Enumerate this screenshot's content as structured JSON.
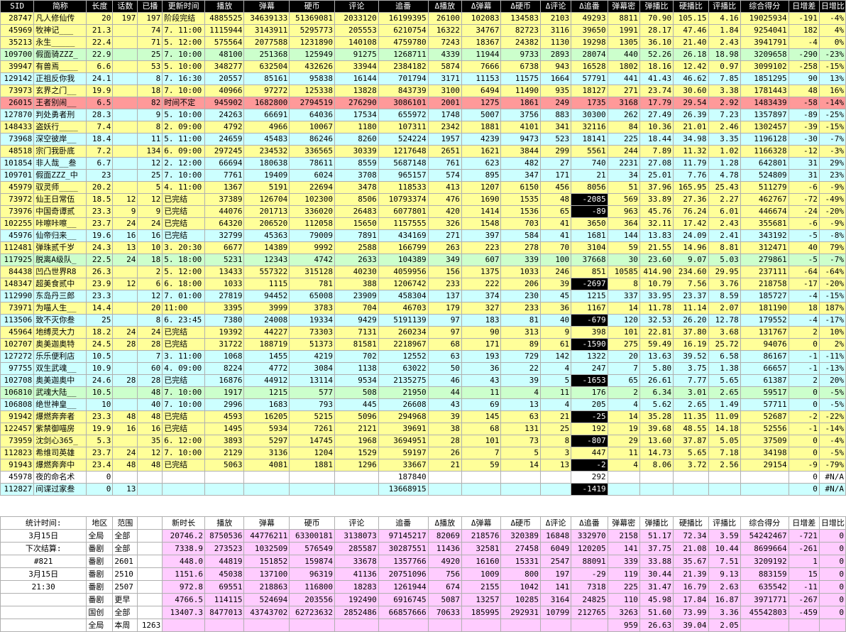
{
  "columns": [
    "SID",
    "简称",
    "长度",
    "话数",
    "已播",
    "更新时间",
    "播放",
    "弹幕",
    "硬币",
    "评论",
    "追番",
    "Δ播放",
    "Δ弹幕",
    "Δ硬币",
    "Δ评论",
    "Δ追番",
    "弹幕密",
    "弹播比",
    "硬播比",
    "评播比",
    "综合得分",
    "日增差",
    "日增比"
  ],
  "rows": [
    [
      "28747",
      "凡人修仙传",
      "20",
      "197",
      "197",
      "阶段完结",
      "4885525",
      "34639133",
      "51369081",
      "2033120",
      "16199395",
      "26100",
      "102083",
      "134583",
      "2103",
      "49293",
      "8811",
      "70.90",
      "105.15",
      "4.16",
      "19025934",
      "-191",
      "-4%"
    ],
    [
      "45969",
      "牧神记___",
      "21.3",
      "",
      "74",
      "7. 11:00",
      "1115944",
      "3143911",
      "5295773",
      "205553",
      "6210754",
      "16322",
      "34767",
      "82723",
      "3116",
      "39650",
      "1991",
      "28.17",
      "47.46",
      "1.84",
      "9254041",
      "182",
      "4%"
    ],
    [
      "35213",
      "永生_____",
      "22.4",
      "",
      "71",
      "5. 12:00",
      "575564",
      "2077588",
      "1231890",
      "140108",
      "4759780",
      "7243",
      "18367",
      "24382",
      "1130",
      "19298",
      "1305",
      "36.10",
      "21.40",
      "2.43",
      "3941791",
      "-4",
      "0%"
    ],
    [
      "109700",
      "假面骑ZZZ_",
      "22.9",
      "",
      "25",
      "7. 10:00",
      "48100",
      "251368",
      "125949",
      "91275",
      "1268711",
      "4339",
      "11944",
      "9733",
      "2893",
      "28074",
      "440",
      "52.26",
      "26.18",
      "18.98",
      "3209658",
      "-290",
      "-23%"
    ],
    [
      "39947",
      "有兽焉____",
      "6.6",
      "",
      "53",
      "5. 10:00",
      "348277",
      "632504",
      "432626",
      "33944",
      "2384182",
      "5874",
      "7666",
      "6738",
      "943",
      "16528",
      "1802",
      "18.16",
      "12.42",
      "0.97",
      "3099102",
      "-258",
      "-15%"
    ],
    [
      "129142",
      "正祖反你我",
      "24.1",
      "",
      "8",
      "7. 16:30",
      "20557",
      "85161",
      "95838",
      "16144",
      "701794",
      "3171",
      "11153",
      "11575",
      "1664",
      "57791",
      "441",
      "41.43",
      "46.62",
      "7.85",
      "1851295",
      "90",
      "13%"
    ],
    [
      "73973",
      "玄界之门__",
      "19.9",
      "",
      "18",
      "7. 10:00",
      "40966",
      "97272",
      "125338",
      "13828",
      "843739",
      "3100",
      "6494",
      "11490",
      "935",
      "18127",
      "271",
      "23.74",
      "30.60",
      "3.38",
      "1781443",
      "48",
      "16%"
    ],
    [
      "26015",
      "王者别闹__",
      "6.5",
      "",
      "82",
      "时间不定",
      "945902",
      "1682800",
      "2794519",
      "276290",
      "3086101",
      "2001",
      "1275",
      "1861",
      "249",
      "1735",
      "3168",
      "17.79",
      "29.54",
      "2.92",
      "1483439",
      "-58",
      "-14%"
    ],
    [
      "127870",
      "判处勇者刑",
      "28.3",
      "",
      "9",
      "5. 10:00",
      "24263",
      "66691",
      "64036",
      "17534",
      "655972",
      "1748",
      "5007",
      "3756",
      "883",
      "30300",
      "262",
      "27.49",
      "26.39",
      "7.23",
      "1357897",
      "-89",
      "-25%"
    ],
    [
      "148433",
      "盗妖行____",
      "7.4",
      "",
      "8",
      "2. 09:00",
      "4792",
      "4966",
      "10067",
      "1180",
      "107311",
      "2342",
      "1881",
      "4101",
      "341",
      "32116",
      "84",
      "10.36",
      "21.01",
      "2.46",
      "1302457",
      "-39",
      "-15%"
    ],
    [
      "73968",
      "深空彼岸__",
      "18.4",
      "",
      "11",
      "5. 11:00",
      "24659",
      "45483",
      "86246",
      "8260",
      "524224",
      "1957",
      "4239",
      "9473",
      "523",
      "18141",
      "225",
      "18.44",
      "34.98",
      "3.35",
      "1196128",
      "-30",
      "-7%"
    ],
    [
      "48518",
      "宗门我卧底",
      "7.2",
      "",
      "134",
      "6. 09:00",
      "297245",
      "234532",
      "336565",
      "30339",
      "1217648",
      "2651",
      "1621",
      "3844",
      "299",
      "5561",
      "244",
      "7.89",
      "11.32",
      "1.02",
      "1166328",
      "-12",
      "-3%"
    ],
    [
      "101854",
      "非人哉__叁",
      "6.7",
      "",
      "12",
      "2. 12:00",
      "66694",
      "180638",
      "78611",
      "8559",
      "5687148",
      "761",
      "623",
      "482",
      "27",
      "740",
      "2231",
      "27.08",
      "11.79",
      "1.28",
      "642801",
      "31",
      "29%"
    ],
    [
      "109701",
      "假面ZZZ_中",
      "23",
      "",
      "25",
      "7. 10:00",
      "7761",
      "19409",
      "6024",
      "3708",
      "965157",
      "574",
      "895",
      "347",
      "171",
      "21",
      "34",
      "25.01",
      "7.76",
      "4.78",
      "524809",
      "31",
      "23%"
    ],
    [
      "45979",
      "驭灵师____",
      "20.2",
      "",
      "5",
      "4. 11:00",
      "1367",
      "5191",
      "22694",
      "3478",
      "118533",
      "413",
      "1207",
      "6150",
      "456",
      "8056",
      "51",
      "37.96",
      "165.95",
      "25.43",
      "511279",
      "-6",
      "-9%"
    ],
    [
      "73972",
      "仙王日常伍",
      "18.5",
      "12",
      "12",
      "已完结",
      "37389",
      "126704",
      "102300",
      "8506",
      "10793374",
      "476",
      "1690",
      "1535",
      "48",
      "-2085",
      "569",
      "33.89",
      "27.36",
      "2.27",
      "462767",
      "-72",
      "-49%"
    ],
    [
      "73976",
      "中国奇谭贰",
      "23.3",
      "9",
      "9",
      "已完结",
      "44076",
      "201713",
      "336020",
      "26483",
      "6077801",
      "420",
      "1414",
      "1536",
      "65",
      "-89",
      "963",
      "45.76",
      "76.24",
      "6.01",
      "446674",
      "-24",
      "-20%"
    ],
    [
      "102255",
      "咔嚓咔嚓__",
      "23.7",
      "24",
      "24",
      "已完结",
      "64320",
      "206520",
      "112058",
      "15650",
      "1157555",
      "326",
      "1548",
      "703",
      "41",
      "3650",
      "364",
      "32.11",
      "17.42",
      "2.43",
      "355681",
      "-6",
      "-9%"
    ],
    [
      "45976",
      "仙帝归来__",
      "19.6",
      "16",
      "16",
      "已完结",
      "32799",
      "45363",
      "79009",
      "7891",
      "434169",
      "271",
      "397",
      "584",
      "41",
      "1681",
      "144",
      "13.83",
      "24.09",
      "2.41",
      "343192",
      "-5",
      "-8%"
    ],
    [
      "112481",
      "弹珠贰千岁",
      "24.3",
      "13",
      "10",
      "3. 20:30",
      "6677",
      "14389",
      "9992",
      "2588",
      "166799",
      "263",
      "223",
      "278",
      "70",
      "3104",
      "59",
      "21.55",
      "14.96",
      "8.81",
      "312471",
      "40",
      "79%"
    ],
    [
      "117925",
      "脱离A级队_",
      "22.5",
      "24",
      "18",
      "5. 18:00",
      "5231",
      "12343",
      "4742",
      "2633",
      "104389",
      "349",
      "607",
      "339",
      "100",
      "37668",
      "30",
      "23.60",
      "9.07",
      "5.03",
      "279861",
      "-5",
      "-7%"
    ],
    [
      "84438",
      "凹凸世界R8",
      "26.3",
      "",
      "2",
      "5. 12:00",
      "13433",
      "557322",
      "315128",
      "40230",
      "4059956",
      "156",
      "1375",
      "1033",
      "246",
      "851",
      "10585",
      "414.90",
      "234.60",
      "29.95",
      "237111",
      "-64",
      "-64%"
    ],
    [
      "148347",
      "超美食贰中",
      "23.9",
      "12",
      "6",
      "6. 18:00",
      "1033",
      "1115",
      "781",
      "388",
      "1206742",
      "233",
      "222",
      "206",
      "39",
      "-2697",
      "8",
      "10.79",
      "7.56",
      "3.76",
      "218758",
      "-17",
      "-20%"
    ],
    [
      "112990",
      "东岛丹三郎",
      "23.3",
      "",
      "12",
      "7. 01:00",
      "27819",
      "94452",
      "65008",
      "23909",
      "458304",
      "137",
      "374",
      "230",
      "45",
      "1215",
      "337",
      "33.95",
      "23.37",
      "8.59",
      "185727",
      "-4",
      "-15%"
    ],
    [
      "73971",
      "为喵人生__",
      "14.4",
      "",
      "20",
      "11:00",
      "3395",
      "3999",
      "3783",
      "704",
      "46703",
      "179",
      "327",
      "233",
      "36",
      "1167",
      "14",
      "11.78",
      "11.14",
      "2.07",
      "181190",
      "18",
      "187%"
    ],
    [
      "113506",
      "致不灭你叁",
      "25",
      "",
      "8",
      "6. 23:45",
      "7380",
      "24008",
      "19334",
      "9429",
      "5191139",
      "97",
      "183",
      "81",
      "40",
      "-679",
      "120",
      "32.53",
      "26.20",
      "12.78",
      "179552",
      "-4",
      "-17%"
    ],
    [
      "45964",
      "地缚灵大力",
      "18.2",
      "24",
      "24",
      "已完结",
      "19392",
      "44227",
      "73303",
      "7131",
      "260234",
      "97",
      "90",
      "313",
      "9",
      "398",
      "101",
      "22.81",
      "37.80",
      "3.68",
      "131767",
      "2",
      "10%"
    ],
    [
      "102707",
      "奥美迦奥特",
      "24.5",
      "28",
      "28",
      "已完结",
      "31722",
      "188719",
      "51373",
      "81581",
      "2218967",
      "68",
      "171",
      "89",
      "61",
      "-1590",
      "275",
      "59.49",
      "16.19",
      "25.72",
      "94076",
      "0",
      "2%"
    ],
    [
      "127272",
      "乐乐便利店",
      "10.5",
      "",
      "7",
      "3. 11:00",
      "1068",
      "1455",
      "4219",
      "702",
      "12552",
      "63",
      "193",
      "729",
      "142",
      "1322",
      "20",
      "13.63",
      "39.52",
      "6.58",
      "86167",
      "-1",
      "-11%"
    ],
    [
      "97755",
      "双生武魂__",
      "10.9",
      "",
      "60",
      "4. 09:00",
      "8224",
      "4772",
      "3084",
      "1138",
      "63022",
      "50",
      "36",
      "22",
      "4",
      "247",
      "7",
      "5.80",
      "3.75",
      "1.38",
      "66657",
      "-1",
      "-13%"
    ],
    [
      "102708",
      "奥美迦奥中",
      "24.6",
      "28",
      "28",
      "已完结",
      "16876",
      "44912",
      "13114",
      "9534",
      "2135275",
      "46",
      "43",
      "39",
      "5",
      "-1653",
      "65",
      "26.61",
      "7.77",
      "5.65",
      "61387",
      "2",
      "20%"
    ],
    [
      "106810",
      "武魂大陆__",
      "10.5",
      "",
      "48",
      "7. 10:00",
      "1917",
      "1215",
      "577",
      "508",
      "21950",
      "44",
      "11",
      "4",
      "11",
      "176",
      "2",
      "6.34",
      "3.01",
      "2.65",
      "59517",
      "0",
      "-5%"
    ],
    [
      "106808",
      "绝世神皇__",
      "10",
      "",
      "40",
      "7. 10:00",
      "2996",
      "1683",
      "793",
      "445",
      "26608",
      "43",
      "69",
      "13",
      "4",
      "205",
      "4",
      "5.62",
      "2.65",
      "1.49",
      "57711",
      "0",
      "-5%"
    ],
    [
      "91942",
      "爆燃奔奔者",
      "23.3",
      "48",
      "48",
      "已完结",
      "4593",
      "16205",
      "5215",
      "5096",
      "294968",
      "39",
      "145",
      "63",
      "21",
      "-25",
      "14",
      "35.28",
      "11.35",
      "11.09",
      "52687",
      "-2",
      "-22%"
    ],
    [
      "122457",
      "紫禁御喵房",
      "19.9",
      "16",
      "16",
      "已完结",
      "1495",
      "5934",
      "7261",
      "2121",
      "39691",
      "38",
      "68",
      "131",
      "25",
      "192",
      "19",
      "39.68",
      "48.55",
      "14.18",
      "52556",
      "-1",
      "-14%"
    ],
    [
      "73959",
      "沈剑心365_",
      "5.3",
      "",
      "35",
      "6. 12:00",
      "3893",
      "5297",
      "14745",
      "1968",
      "3694951",
      "28",
      "101",
      "73",
      "8",
      "-807",
      "29",
      "13.60",
      "37.87",
      "5.05",
      "37509",
      "0",
      "-4%"
    ],
    [
      "112823",
      "希维司英雄",
      "23.7",
      "24",
      "12",
      "7. 10:00",
      "2129",
      "3136",
      "1204",
      "1529",
      "59197",
      "26",
      "7",
      "5",
      "3",
      "447",
      "11",
      "14.73",
      "5.65",
      "7.18",
      "34198",
      "0",
      "-5%"
    ],
    [
      "91943",
      "爆燃奔奔中",
      "23.4",
      "48",
      "48",
      "已完结",
      "5063",
      "4081",
      "1881",
      "1296",
      "33667",
      "21",
      "59",
      "14",
      "13",
      "-2",
      "4",
      "8.06",
      "3.72",
      "2.56",
      "29154",
      "-9",
      "-79%"
    ],
    [
      "45978",
      "夜的命名术",
      "0",
      "",
      "",
      "",
      "",
      "",
      "",
      "",
      "187840",
      "",
      "",
      "",
      "",
      "292",
      "",
      "",
      "",
      "",
      "",
      "0",
      "#N/A"
    ],
    [
      "112827",
      "间谍过家叁",
      "0",
      "13",
      "",
      "",
      "",
      "",
      "",
      "",
      "13668915",
      "",
      "",
      "",
      "",
      "-1419",
      "",
      "",
      "",
      "",
      "",
      "0",
      "#N/A"
    ]
  ],
  "stats": {
    "labels": [
      "统计时间:",
      "3月15日",
      "下次结算:",
      "#821",
      "3月15日",
      "21:30"
    ],
    "columns": [
      "地区",
      "范围",
      "",
      "新时长",
      "播放",
      "弹幕",
      "硬币",
      "评论",
      "追番",
      "Δ播放",
      "Δ弹幕",
      "Δ硬币",
      "Δ评论",
      "Δ追番",
      "弹幕密",
      "弹播比",
      "硬播比",
      "评播比",
      "综合得分",
      "日增差",
      "日增比"
    ],
    "rows": [
      [
        "全局",
        "全部",
        "",
        "20746.2",
        "8750536",
        "44776211",
        "63300181",
        "3138073",
        "97145217",
        "82069",
        "218576",
        "320389",
        "16848",
        "332970",
        "2158",
        "51.17",
        "72.34",
        "3.59",
        "54242467",
        "-721",
        "0"
      ],
      [
        "番剧",
        "全部",
        "",
        "7338.9",
        "273523",
        "1032509",
        "576549",
        "285587",
        "30287551",
        "11436",
        "32581",
        "27458",
        "6049",
        "120205",
        "141",
        "37.75",
        "21.08",
        "10.44",
        "8699664",
        "-261",
        "0"
      ],
      [
        "番剧",
        "2601",
        "",
        "448.0",
        "44819",
        "151852",
        "159874",
        "33678",
        "1357766",
        "4920",
        "16160",
        "15331",
        "2547",
        "88091",
        "339",
        "33.88",
        "35.67",
        "7.51",
        "3209192",
        "1",
        "0"
      ],
      [
        "番剧",
        "2510",
        "",
        "1151.6",
        "45038",
        "137100",
        "96319",
        "41136",
        "20751096",
        "756",
        "1009",
        "800",
        "197",
        "-29",
        "119",
        "30.44",
        "21.39",
        "9.13",
        "883159",
        "15",
        "0"
      ],
      [
        "番剧",
        "2507",
        "",
        "972.8",
        "69551",
        "218863",
        "116800",
        "18283",
        "1261944",
        "674",
        "2155",
        "1042",
        "141",
        "7318",
        "225",
        "31.47",
        "16.79",
        "2.63",
        "635542",
        "-11",
        "0"
      ],
      [
        "番剧",
        "更早",
        "",
        "4766.5",
        "114115",
        "524694",
        "203556",
        "192490",
        "6916745",
        "5087",
        "13257",
        "10285",
        "3164",
        "24825",
        "110",
        "45.98",
        "17.84",
        "16.87",
        "3971771",
        "-267",
        "0"
      ],
      [
        "国创",
        "全部",
        "",
        "13407.3",
        "8477013",
        "43743702",
        "62723632",
        "2852486",
        "66857666",
        "70633",
        "185995",
        "292931",
        "10799",
        "212765",
        "3263",
        "51.60",
        "73.99",
        "3.36",
        "45542803",
        "-459",
        "0"
      ],
      [
        "全局",
        "本周",
        "1263",
        "",
        "",
        "",
        "",
        "",
        "",
        "",
        "",
        "",
        "",
        "",
        "959",
        "26.63",
        "39.04",
        "2.05",
        "",
        "",
        ""
      ]
    ]
  }
}
